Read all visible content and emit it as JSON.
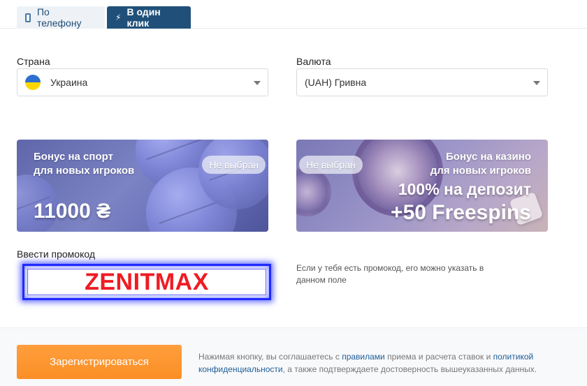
{
  "tabs": [
    {
      "label": "По телефону",
      "icon": "phone-icon",
      "active": false
    },
    {
      "label": "В один клик",
      "icon": "lightning-icon",
      "active": true
    }
  ],
  "country": {
    "label": "Страна",
    "value": "Украина",
    "flag": "ukraine-flag-icon"
  },
  "currency": {
    "label": "Валюта",
    "value": "(UAH) Гривна"
  },
  "bonuses": {
    "sport": {
      "title_line1": "Бонус на спорт",
      "title_line2": "для новых игроков",
      "status": "Не выбран",
      "amount": "11000 ₴"
    },
    "casino": {
      "title_line1": "Бонус на казино",
      "title_line2": "для новых игроков",
      "status": "Не выбран",
      "amount_line1": "100% на депозит",
      "amount_line2": "+50 Freespins"
    }
  },
  "promo": {
    "label": "Ввести промокод",
    "value": "ZENITMAX",
    "hint": "Если у тебя есть промокод, его можно указать в данном поле"
  },
  "footer": {
    "register_label": "Зарегистрироваться",
    "agree_text_1": "Нажимая кнопку, вы соглашаетесь с ",
    "rules_link": "правилами",
    "agree_text_2": " приема и расчета ставок и ",
    "privacy_link": "политикой конфиденциальности",
    "agree_text_3": ", а также подтверждаете достоверность вышеуказанных данных."
  },
  "colors": {
    "accent": "#20507a",
    "register": "#fb8f25",
    "promo_text": "#ee1c24",
    "promo_border": "#1f2bff"
  }
}
